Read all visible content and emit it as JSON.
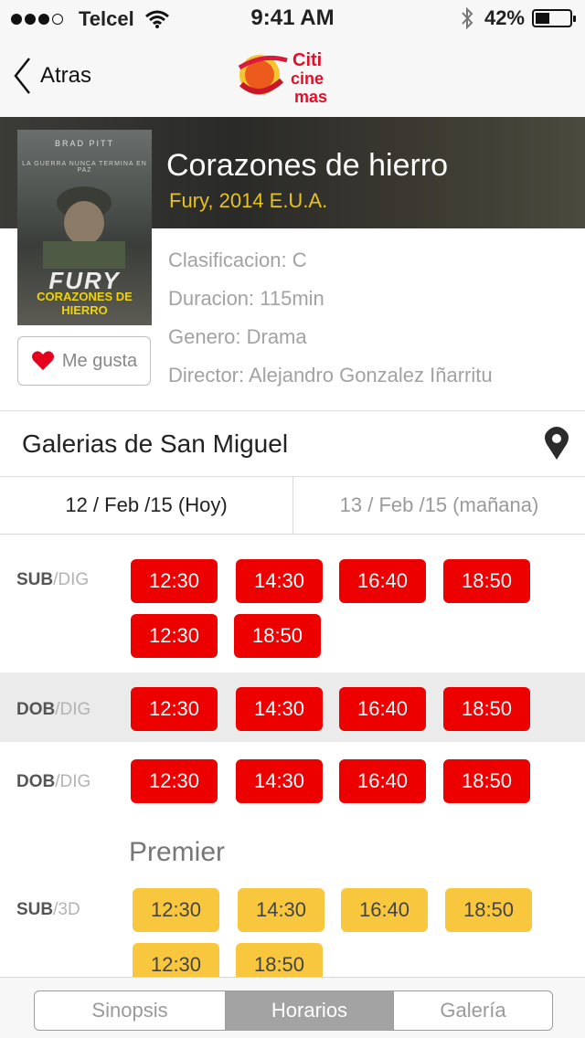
{
  "status_bar": {
    "carrier": "Telcel",
    "time": "9:41 AM",
    "battery": "42%",
    "battery_level": 0.42
  },
  "nav": {
    "back_label": "Atras",
    "logo_text": [
      "Citi",
      "cine",
      "mas"
    ]
  },
  "movie": {
    "title": "Corazones de hierro",
    "subtitle": "Fury, 2014 E.U.A.",
    "poster": {
      "actor": "BRAD PITT",
      "tagline": "LA GUERRA NUNCA TERMINA EN PAZ",
      "title_en": "FURY",
      "title_es": "CORAZONES DE HIERRO"
    },
    "details": [
      "Clasificacion: C",
      "Duracion: 115min",
      "Genero: Drama",
      "Director: Alejandro Gonzalez Iñarritu"
    ],
    "like_label": "Me gusta"
  },
  "cinema": {
    "name": "Galerias de San Miguel"
  },
  "dates": [
    {
      "label": "12 / Feb /15 (Hoy)",
      "active": true
    },
    {
      "label": "13 / Feb /15 (mañana)",
      "active": false
    }
  ],
  "showtimes": [
    {
      "lang": "SUB",
      "format": "DIG",
      "times": [
        "12:30",
        "14:30",
        "16:40",
        "18:50",
        "12:30",
        "18:50"
      ]
    },
    {
      "lang": "DOB",
      "format": "DIG",
      "times": [
        "12:30",
        "14:30",
        "16:40",
        "18:50"
      ]
    },
    {
      "lang": "DOB",
      "format": "DIG",
      "times": [
        "12:30",
        "14:30",
        "16:40",
        "18:50"
      ]
    }
  ],
  "premier": {
    "label": "Premier",
    "rows": [
      {
        "lang": "SUB",
        "format": "3D",
        "times": [
          "12:30",
          "14:30",
          "16:40",
          "18:50",
          "12:30",
          "18:50"
        ]
      }
    ]
  },
  "tabs": [
    {
      "label": "Sinopsis",
      "active": false
    },
    {
      "label": "Horarios",
      "active": true
    },
    {
      "label": "Galería",
      "active": false
    }
  ],
  "colors": {
    "accent_red": "#ec0000",
    "premier_yellow": "#f9c73e",
    "subtitle_gold": "#e6c31d"
  }
}
